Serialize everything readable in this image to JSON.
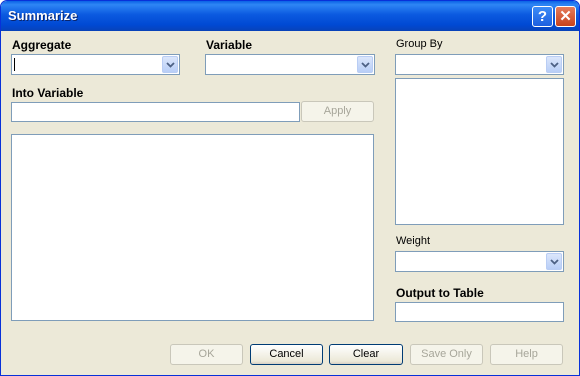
{
  "window": {
    "title": "Summarize",
    "help_glyph": "?",
    "close_glyph": "✕"
  },
  "labels": {
    "aggregate": "Aggregate",
    "variable": "Variable",
    "group_by": "Group By",
    "into_variable": "Into Variable",
    "weight": "Weight",
    "output_to_table": "Output to Table"
  },
  "fields": {
    "aggregate": "",
    "variable": "",
    "group_by": "",
    "into_variable": "",
    "weight": "",
    "output_to_table": ""
  },
  "buttons": {
    "apply": "Apply",
    "ok": "OK",
    "cancel": "Cancel",
    "clear": "Clear",
    "save_only": "Save Only",
    "help": "Help"
  }
}
